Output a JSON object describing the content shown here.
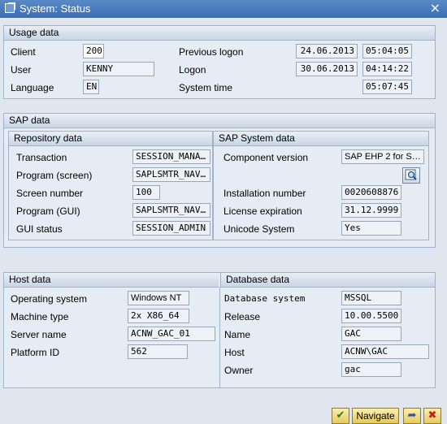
{
  "window": {
    "title": "System: Status",
    "close_glyph": "×"
  },
  "usage": {
    "header": "Usage data",
    "client_label": "Client",
    "client_value": "200",
    "user_label": "User",
    "user_value": "KENNY",
    "language_label": "Language",
    "language_value": "EN",
    "prev_logon_label": "Previous logon",
    "prev_logon_date": "24.06.2013",
    "prev_logon_time": "05:04:05",
    "logon_label": "Logon",
    "logon_date": "30.06.2013",
    "logon_time": "04:14:22",
    "system_time_label": "System time",
    "system_time_value": "05:07:45"
  },
  "sap": {
    "header": "SAP data",
    "repository": {
      "header": "Repository data",
      "transaction_label": "Transaction",
      "transaction_value": "SESSION_MANA…",
      "program_screen_label": "Program (screen)",
      "program_screen_value": "SAPLSMTR_NAV…",
      "screen_number_label": "Screen number",
      "screen_number_value": "100",
      "program_gui_label": "Program (GUI)",
      "program_gui_value": "SAPLSMTR_NAV…",
      "gui_status_label": "GUI status",
      "gui_status_value": "SESSION_ADMIN"
    },
    "system": {
      "header": "SAP System data",
      "component_label": "Component version",
      "component_value": "SAP EHP 2 for S…",
      "installation_label": "Installation number",
      "installation_value": "0020608876",
      "license_label": "License expiration",
      "license_value": "31.12.9999",
      "unicode_label": "Unicode System",
      "unicode_value": "Yes",
      "details_icon": "magnifier-icon"
    }
  },
  "host": {
    "header": "Host data",
    "os_label": "Operating system",
    "os_value": "Windows NT",
    "machine_label": "Machine type",
    "machine_value": "2x X86_64",
    "server_label": "Server name",
    "server_value": "ACNW_GAC_01",
    "platform_label": "Platform ID",
    "platform_value": "562"
  },
  "database": {
    "header": "Database data",
    "dbsys_label": "Database system",
    "dbsys_value": "MSSQL",
    "release_label": "Release",
    "release_value": "10.00.5500",
    "name_label": "Name",
    "name_value": "GAC",
    "host_label": "Host",
    "host_value": "ACNW\\GAC",
    "owner_label": "Owner",
    "owner_value": "gac"
  },
  "footer": {
    "ok_icon": "checkmark-icon",
    "ok_glyph": "✔",
    "navigate_label": "Navigate",
    "other_icon": "arrow-right-icon",
    "other_glyph": "➦",
    "cancel_icon": "close-icon",
    "cancel_glyph": "✖"
  }
}
